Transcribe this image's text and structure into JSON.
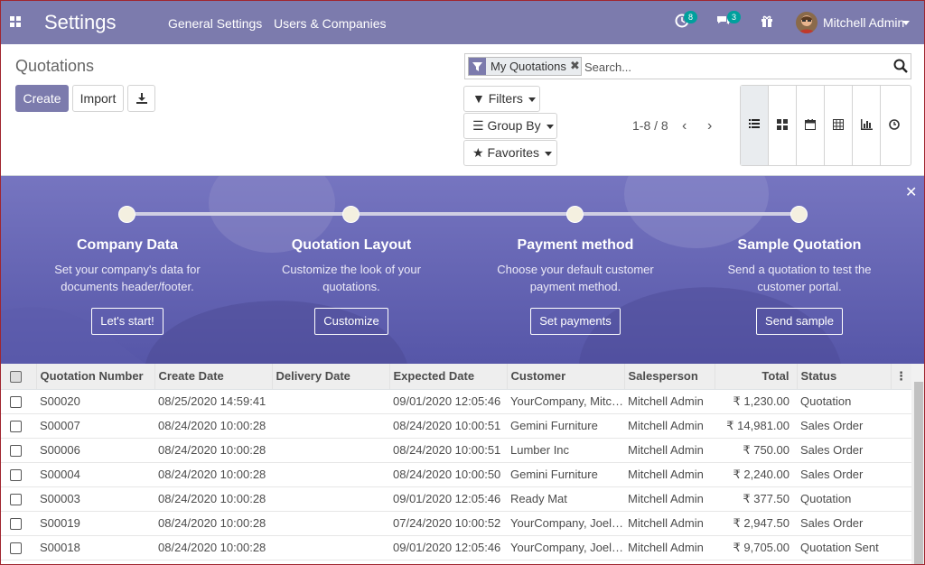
{
  "navbar": {
    "app_title": "Settings",
    "menus": [
      "General Settings",
      "Users & Companies"
    ],
    "activity_badge": "8",
    "messages_badge": "3",
    "user_name": "Mitchell Admin",
    "color": "#7c7bad"
  },
  "control": {
    "breadcrumb": "Quotations",
    "create_label": "Create",
    "import_label": "Import",
    "facet_label": "My Quotations",
    "search_placeholder": "Search...",
    "filters_label": "Filters",
    "groupby_label": "Group By",
    "favorites_label": "Favorites",
    "pager_value": "1-8 / 8",
    "views": [
      "list-view-icon",
      "kanban-view-icon",
      "calendar-view-icon",
      "pivot-view-icon",
      "graph-view-icon",
      "activity-view-icon"
    ],
    "active_view": "list"
  },
  "banner": {
    "steps": [
      {
        "title": "Company Data",
        "desc1": "Set your company's data for",
        "desc2": "documents header/footer.",
        "button": "Let's start!"
      },
      {
        "title": "Quotation Layout",
        "desc1": "Customize the look of your",
        "desc2": "quotations.",
        "button": "Customize"
      },
      {
        "title": "Payment method",
        "desc1": "Choose your default customer",
        "desc2": "payment method.",
        "button": "Set payments"
      },
      {
        "title": "Sample Quotation",
        "desc1": "Send a quotation to test the",
        "desc2": "customer portal.",
        "button": "Send sample"
      }
    ]
  },
  "table": {
    "columns": [
      "Quotation Number",
      "Create Date",
      "Delivery Date",
      "Expected Date",
      "Customer",
      "Salesperson",
      "Total",
      "Status"
    ],
    "rows": [
      {
        "number": "S00020",
        "create": "08/25/2020 14:59:41",
        "delivery": "",
        "expected": "09/01/2020 12:05:46",
        "customer": "YourCompany, Mitchell Admin",
        "salesperson": "Mitchell Admin",
        "total": "₹ 1,230.00",
        "status": "Quotation"
      },
      {
        "number": "S00007",
        "create": "08/24/2020 10:00:28",
        "delivery": "",
        "expected": "08/24/2020 10:00:51",
        "customer": "Gemini Furniture",
        "salesperson": "Mitchell Admin",
        "total": "₹ 14,981.00",
        "status": "Sales Order"
      },
      {
        "number": "S00006",
        "create": "08/24/2020 10:00:28",
        "delivery": "",
        "expected": "08/24/2020 10:00:51",
        "customer": "Lumber Inc",
        "salesperson": "Mitchell Admin",
        "total": "₹ 750.00",
        "status": "Sales Order"
      },
      {
        "number": "S00004",
        "create": "08/24/2020 10:00:28",
        "delivery": "",
        "expected": "08/24/2020 10:00:50",
        "customer": "Gemini Furniture",
        "salesperson": "Mitchell Admin",
        "total": "₹ 2,240.00",
        "status": "Sales Order"
      },
      {
        "number": "S00003",
        "create": "08/24/2020 10:00:28",
        "delivery": "",
        "expected": "09/01/2020 12:05:46",
        "customer": "Ready Mat",
        "salesperson": "Mitchell Admin",
        "total": "₹ 377.50",
        "status": "Quotation"
      },
      {
        "number": "S00019",
        "create": "08/24/2020 10:00:28",
        "delivery": "",
        "expected": "07/24/2020 10:00:52",
        "customer": "YourCompany, Joel Willis",
        "salesperson": "Mitchell Admin",
        "total": "₹ 2,947.50",
        "status": "Sales Order"
      },
      {
        "number": "S00018",
        "create": "08/24/2020 10:00:28",
        "delivery": "",
        "expected": "09/01/2020 12:05:46",
        "customer": "YourCompany, Joel Willis",
        "salesperson": "Mitchell Admin",
        "total": "₹ 9,705.00",
        "status": "Quotation Sent"
      }
    ]
  }
}
